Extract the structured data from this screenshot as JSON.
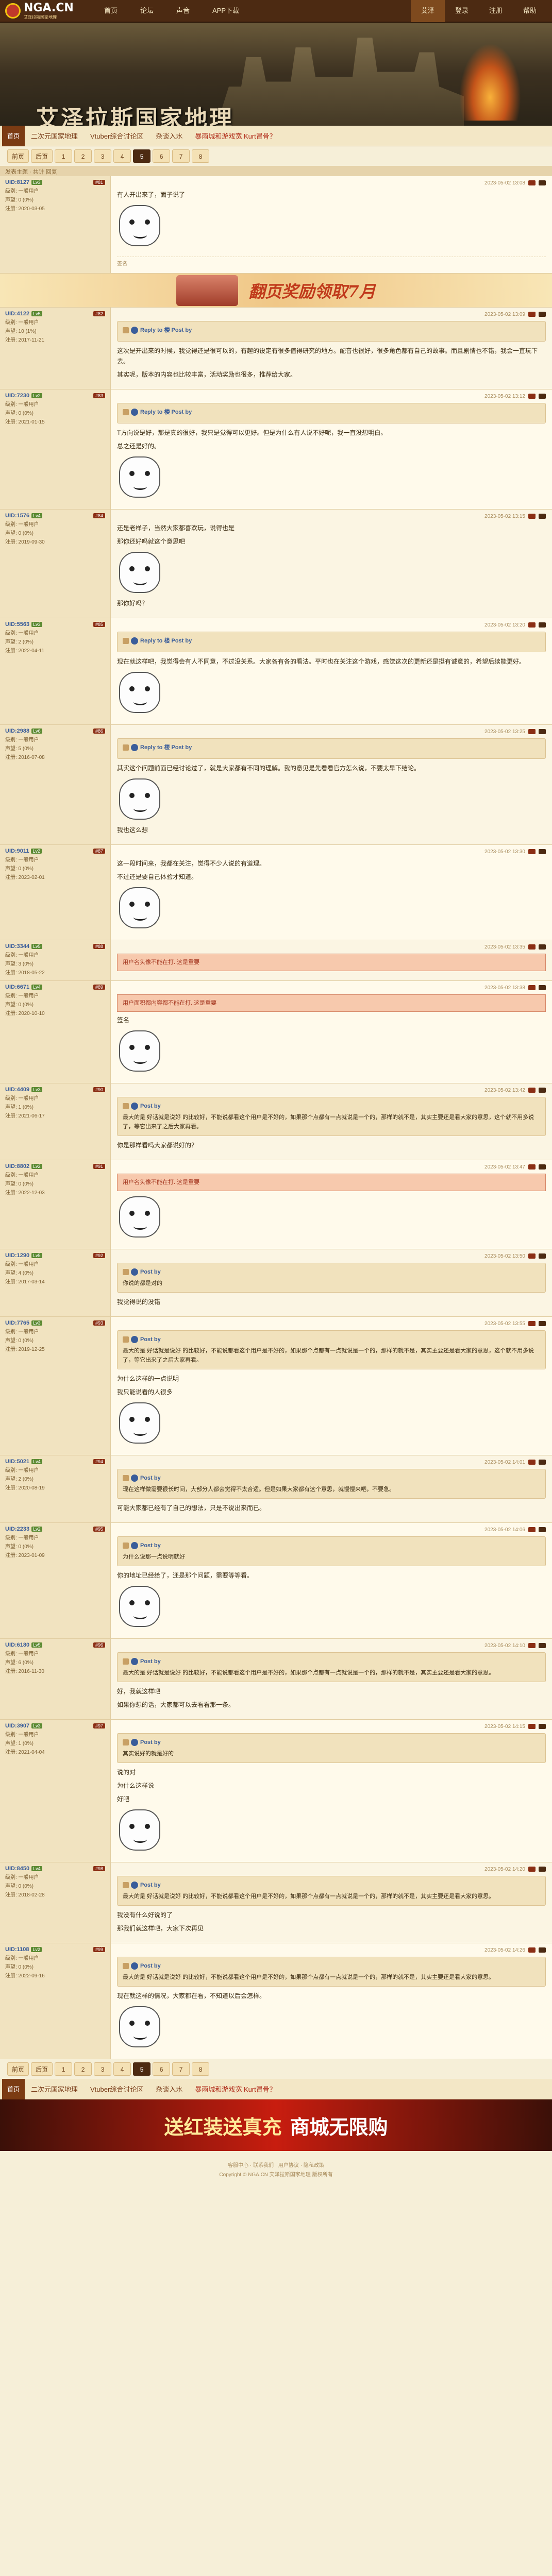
{
  "nav": {
    "logo_text": "NGA.CN",
    "logo_sub": "艾泽拉斯国家地理",
    "links": [
      "首页",
      "论坛",
      "声音",
      "APP下载"
    ],
    "right_links": [
      "艾泽",
      "登录",
      "注册",
      "帮助"
    ]
  },
  "banner": {
    "title": "艾泽拉斯国家地理"
  },
  "subnav": {
    "home_label": "首页",
    "links": [
      "二次元国家地理",
      "Vtuber综合讨论区",
      "杂谈入水",
      "暴雨城和游戏宽 Kurt冒骨？"
    ]
  },
  "pager_top": [
    "前页",
    "后页",
    "1",
    "2",
    "3",
    "4",
    "5",
    "6",
    "7",
    "8"
  ],
  "pager_current": "5",
  "topic_head": "发表主题 · 共计 回复",
  "ad1": {
    "text": "翻页奖励领取7月"
  },
  "posts": [
    {
      "uid": "UID:8127",
      "level": "Lv3",
      "floor": "#81",
      "side": [
        "级别: 一般用户",
        "声望: 0 (0%)",
        "注册: 2020-03-05"
      ],
      "time": "2023-05-02 13:08",
      "text": [
        "有人开出来了，面子说了"
      ],
      "footer": "签名"
    },
    {
      "uid": "UID:4122",
      "level": "Lv5",
      "floor": "#82",
      "side": [
        "级别: 一般用户",
        "声望: 10 (1%)",
        "注册: 2017-11-21"
      ],
      "time": "2023-05-02 13:09",
      "quote_user": "Reply to 楼 Post by",
      "text": [
        "这次是开出来的时候，我觉得还是很可以的，有趣的设定有很多值得研究的地方。配音也很好，很多角色都有自己的故事。而且剧情也不错，我会一直玩下去。",
        "其实呢，版本的内容也比较丰富，活动奖励也很多，推荐给大家。"
      ]
    },
    {
      "uid": "UID:7230",
      "level": "Lv2",
      "floor": "#83",
      "side": [
        "级别: 一般用户",
        "声望: 0 (0%)",
        "注册: 2021-01-15"
      ],
      "time": "2023-05-02 13:12",
      "quote_user": "Reply to 楼 Post by",
      "text": [
        "T方向说是好，那是真的很好，我只是觉得可以更好。但是为什么有人说不好呢，我一直没想明白。",
        "总之还是好的。"
      ]
    },
    {
      "uid": "UID:1576",
      "level": "Lv4",
      "floor": "#84",
      "side": [
        "级别: 一般用户",
        "声望: 0 (0%)",
        "注册: 2019-09-30"
      ],
      "time": "2023-05-02 13:15",
      "text": [
        "还是老样子，当然大家都喜欢玩，说得也是",
        "那你还好吗就这个意思吧"
      ],
      "extra": "那你好吗？"
    },
    {
      "uid": "UID:5563",
      "level": "Lv3",
      "floor": "#85",
      "side": [
        "级别: 一般用户",
        "声望: 2 (0%)",
        "注册: 2022-04-11"
      ],
      "time": "2023-05-02 13:20",
      "quote_user": "Reply to 楼 Post by",
      "text": [
        "现在就这样吧，我觉得会有人不同意，不过没关系。大家各有各的看法。平时也在关注这个游戏，感觉这次的更新还是挺有诚意的，希望后续能更好。"
      ]
    },
    {
      "uid": "UID:2988",
      "level": "Lv6",
      "floor": "#86",
      "side": [
        "级别: 一般用户",
        "声望: 5 (0%)",
        "注册: 2016-07-08"
      ],
      "time": "2023-05-02 13:25",
      "quote_user": "Reply to 楼 Post by",
      "text": [
        "其实这个问题前面已经讨论过了，就是大家都有不同的理解。我的意见是先看看官方怎么说，不要太早下结论。"
      ],
      "extra": "我也这么想"
    },
    {
      "uid": "UID:9011",
      "level": "Lv2",
      "floor": "#87",
      "side": [
        "级别: 一般用户",
        "声望: 0 (0%)",
        "注册: 2023-02-01"
      ],
      "time": "2023-05-02 13:30",
      "text": [
        "这一段时间来，我都在关注，觉得不少人说的有道理。",
        "不过还是要自己体验才知道。"
      ]
    },
    {
      "uid": "UID:3344",
      "level": "Lv5",
      "floor": "#88",
      "side": [
        "级别: 一般用户",
        "声望: 3 (0%)",
        "注册: 2018-05-22"
      ],
      "time": "2023-05-02 13:35",
      "warn": "用户名头像不能在打..这是重要",
      "text": []
    },
    {
      "uid": "UID:6671",
      "level": "Lv4",
      "floor": "#89",
      "side": [
        "级别: 一般用户",
        "声望: 0 (0%)",
        "注册: 2020-10-10"
      ],
      "time": "2023-05-02 13:38",
      "warn": "用户面积都内容都不能在打..这是重要",
      "text": [
        "签名"
      ]
    },
    {
      "uid": "UID:4409",
      "level": "Lv3",
      "floor": "#90",
      "side": [
        "级别: 一般用户",
        "声望: 1 (0%)",
        "注册: 2021-06-17"
      ],
      "time": "2023-05-02 13:42",
      "quote_user": "Post by",
      "quote": "最大的是 好话就是说好 的比较好，不能说都看这个用户是不好的，如果那个点都有一点就说是一个的，那样的就不是，其实主要还是看大家的意思，这个就不用多说了，等它出来了之后大家再看。",
      "text": [
        "你是那样看吗大家都说好的？"
      ]
    },
    {
      "uid": "UID:8802",
      "level": "Lv2",
      "floor": "#91",
      "side": [
        "级别: 一般用户",
        "声望: 0 (0%)",
        "注册: 2022-12-03"
      ],
      "time": "2023-05-02 13:47",
      "warn": "用户名头像不能在打..这是重要",
      "text": []
    },
    {
      "uid": "UID:1290",
      "level": "Lv5",
      "floor": "#92",
      "side": [
        "级别: 一般用户",
        "声望: 4 (0%)",
        "注册: 2017-03-14"
      ],
      "time": "2023-05-02 13:50",
      "quote_user": "Post by",
      "quote": "你说的都是对的",
      "text": [
        "我觉得说的没错"
      ]
    },
    {
      "uid": "UID:7765",
      "level": "Lv3",
      "floor": "#93",
      "side": [
        "级别: 一般用户",
        "声望: 0 (0%)",
        "注册: 2019-12-25"
      ],
      "time": "2023-05-02 13:55",
      "quote_user": "Post by",
      "quote": "最大的是 好话就是说好 的比较好，不能说都看这个用户是不好的，如果那个点都有一点就说是一个的，那样的就不是，其实主要还是看大家的意思，这个就不用多说了，等它出来了之后大家再看。",
      "text": [
        "为什么这样的一点说明",
        "我只能说看的人很多"
      ]
    },
    {
      "uid": "UID:5021",
      "level": "Lv4",
      "floor": "#94",
      "side": [
        "级别: 一般用户",
        "声望: 2 (0%)",
        "注册: 2020-08-19"
      ],
      "time": "2023-05-02 14:01",
      "quote_user": "Post by",
      "quote": "现在这样做需要很长时间，大部分人都会觉得不太合适。但是如果大家都有这个意思，就慢慢来吧，不要急。",
      "text": [
        "可能大家都已经有了自己的想法，只是不说出来而已。"
      ]
    },
    {
      "uid": "UID:2233",
      "level": "Lv2",
      "floor": "#95",
      "side": [
        "级别: 一般用户",
        "声望: 0 (0%)",
        "注册: 2023-01-09"
      ],
      "time": "2023-05-02 14:06",
      "quote_user": "Post by",
      "quote": "为什么说那一点说明就好",
      "text": [
        "你的地址已经给了，还是那个问题，需要等等看。"
      ]
    },
    {
      "uid": "UID:6180",
      "level": "Lv5",
      "floor": "#96",
      "side": [
        "级别: 一般用户",
        "声望: 6 (0%)",
        "注册: 2016-11-30"
      ],
      "time": "2023-05-02 14:10",
      "quote_user": "Post by",
      "quote": "最大的是 好话就是说好 的比较好，不能说都看这个用户是不好的，如果那个点都有一点就说是一个的，那样的就不是，其实主要还是看大家的意思。",
      "text": [
        "好，我就这样吧",
        "如果你想的话，大家都可以去看看那一条。"
      ]
    },
    {
      "uid": "UID:3907",
      "level": "Lv3",
      "floor": "#97",
      "side": [
        "级别: 一般用户",
        "声望: 1 (0%)",
        "注册: 2021-04-04"
      ],
      "time": "2023-05-02 14:15",
      "quote_user": "Post by",
      "quote": "其实说好的就是好的",
      "text": [
        "说的对",
        "为什么这样说",
        "好吧"
      ]
    },
    {
      "uid": "UID:8450",
      "level": "Lv4",
      "floor": "#98",
      "side": [
        "级别: 一般用户",
        "声望: 0 (0%)",
        "注册: 2018-02-28"
      ],
      "time": "2023-05-02 14:20",
      "quote_user": "Post by",
      "quote": "最大的是 好话就是说好 的比较好，不能说都看这个用户是不好的，如果那个点都有一点就说是一个的，那样的就不是，其实主要还是看大家的意思。",
      "text": [
        "我没有什么好说的了",
        "那我们就这样吧，大家下次再见"
      ]
    },
    {
      "uid": "UID:1108",
      "level": "Lv2",
      "floor": "#99",
      "side": [
        "级别: 一般用户",
        "声望: 0 (0%)",
        "注册: 2022-09-16"
      ],
      "time": "2023-05-02 14:26",
      "quote_user": "Post by",
      "quote": "最大的是 好话就是说好 的比较好，不能说都看这个用户是不好的，如果那个点都有一点就说是一个的，那样的就不是，其实主要还是看大家的意思。",
      "text": [
        "现在就这样的情况，大家都在看，不知道以后会怎样。"
      ]
    }
  ],
  "pager_bottom": [
    "前页",
    "后页",
    "1",
    "2",
    "3",
    "4",
    "5",
    "6",
    "7",
    "8"
  ],
  "subnav_bottom": [
    "二次元国家地理",
    "Vtuber综合讨论区",
    "杂谈入水",
    "暴雨城和游戏宽 Kurt冒骨？"
  ],
  "bottom_ad": {
    "t1": "送红装送真充",
    "t2": "商城无限购"
  },
  "footer_lines": [
    "客服中心 · 联系我们 · 用户协议 · 隐私政策",
    "Copyright © NGA.CN 艾泽拉斯国家地理 版权所有"
  ],
  "colors": {
    "brand": "#4c2a12",
    "accent": "#8b2e14",
    "bg": "#f6efd8",
    "warn_bg": "#f7c9ad"
  }
}
